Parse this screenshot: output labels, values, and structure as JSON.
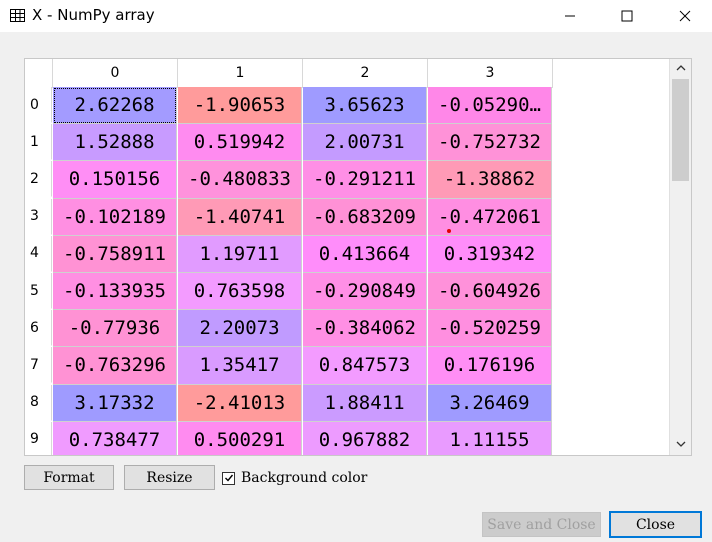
{
  "window": {
    "title": "X - NumPy array",
    "icons": {
      "app": "table-icon",
      "minimize": "minimize-icon",
      "maximize": "maximize-icon",
      "close": "close-icon"
    }
  },
  "table": {
    "column_headers": [
      "0",
      "1",
      "2",
      "3"
    ],
    "row_headers": [
      "0",
      "1",
      "2",
      "3",
      "4",
      "5",
      "6",
      "7",
      "8",
      "9"
    ],
    "rows": [
      [
        "2.62268",
        "-1.90653",
        "3.65623",
        "-0.05290…"
      ],
      [
        "1.52888",
        "0.519942",
        "2.00731",
        "-0.752732"
      ],
      [
        "0.150156",
        "-0.480833",
        "-0.291211",
        "-1.38862"
      ],
      [
        "-0.102189",
        "-1.40741",
        "-0.683209",
        "-0.472061"
      ],
      [
        "-0.758911",
        "1.19711",
        "0.413664",
        "0.319342"
      ],
      [
        "-0.133935",
        "0.763598",
        "-0.290849",
        "-0.604926"
      ],
      [
        "-0.77936",
        "2.20073",
        "-0.384062",
        "-0.520259"
      ],
      [
        "-0.763296",
        "1.35417",
        "0.847573",
        "0.176196"
      ],
      [
        "3.17332",
        "-2.41013",
        "1.88411",
        "3.26469"
      ],
      [
        "0.738477",
        "0.500291",
        "0.967882",
        "1.11155"
      ]
    ],
    "background_colors": [
      [
        "#a39bff",
        "#ff9b9b",
        "#9f9bff",
        "#ff87e8"
      ],
      [
        "#c89bff",
        "#ff8bf0",
        "#c49bff",
        "#ff92d8"
      ],
      [
        "#ff8ef5",
        "#ff92dc",
        "#ff8fe6",
        "#ff9ab6"
      ],
      [
        "#ff8fe2",
        "#ff9ab6",
        "#ff91d6",
        "#ff8ee2"
      ],
      [
        "#ff92d4",
        "#e19bff",
        "#ff8dfa",
        "#ff8dfa"
      ],
      [
        "#ff8fe2",
        "#f39bff",
        "#ff8fe6",
        "#ff91da"
      ],
      [
        "#ff92d4",
        "#c09bff",
        "#ff8fe4",
        "#ff8fe0"
      ],
      [
        "#ff92d4",
        "#d99bff",
        "#f39bff",
        "#ff8ef5"
      ],
      [
        "#9f9bff",
        "#ff9b9b",
        "#cb9bff",
        "#9f9bff"
      ],
      [
        "#f09bff",
        "#ff8bf0",
        "#ed9bff",
        "#e99bff"
      ]
    ],
    "selected_cell": "0,0"
  },
  "scrollbar": {
    "up_icon": "chevron-up-icon",
    "down_icon": "chevron-down-icon"
  },
  "buttons": {
    "format": "Format",
    "resize": "Resize",
    "save_and_close": "Save and Close",
    "close": "Close"
  },
  "background_color": {
    "label": "Background color",
    "checked": true
  }
}
